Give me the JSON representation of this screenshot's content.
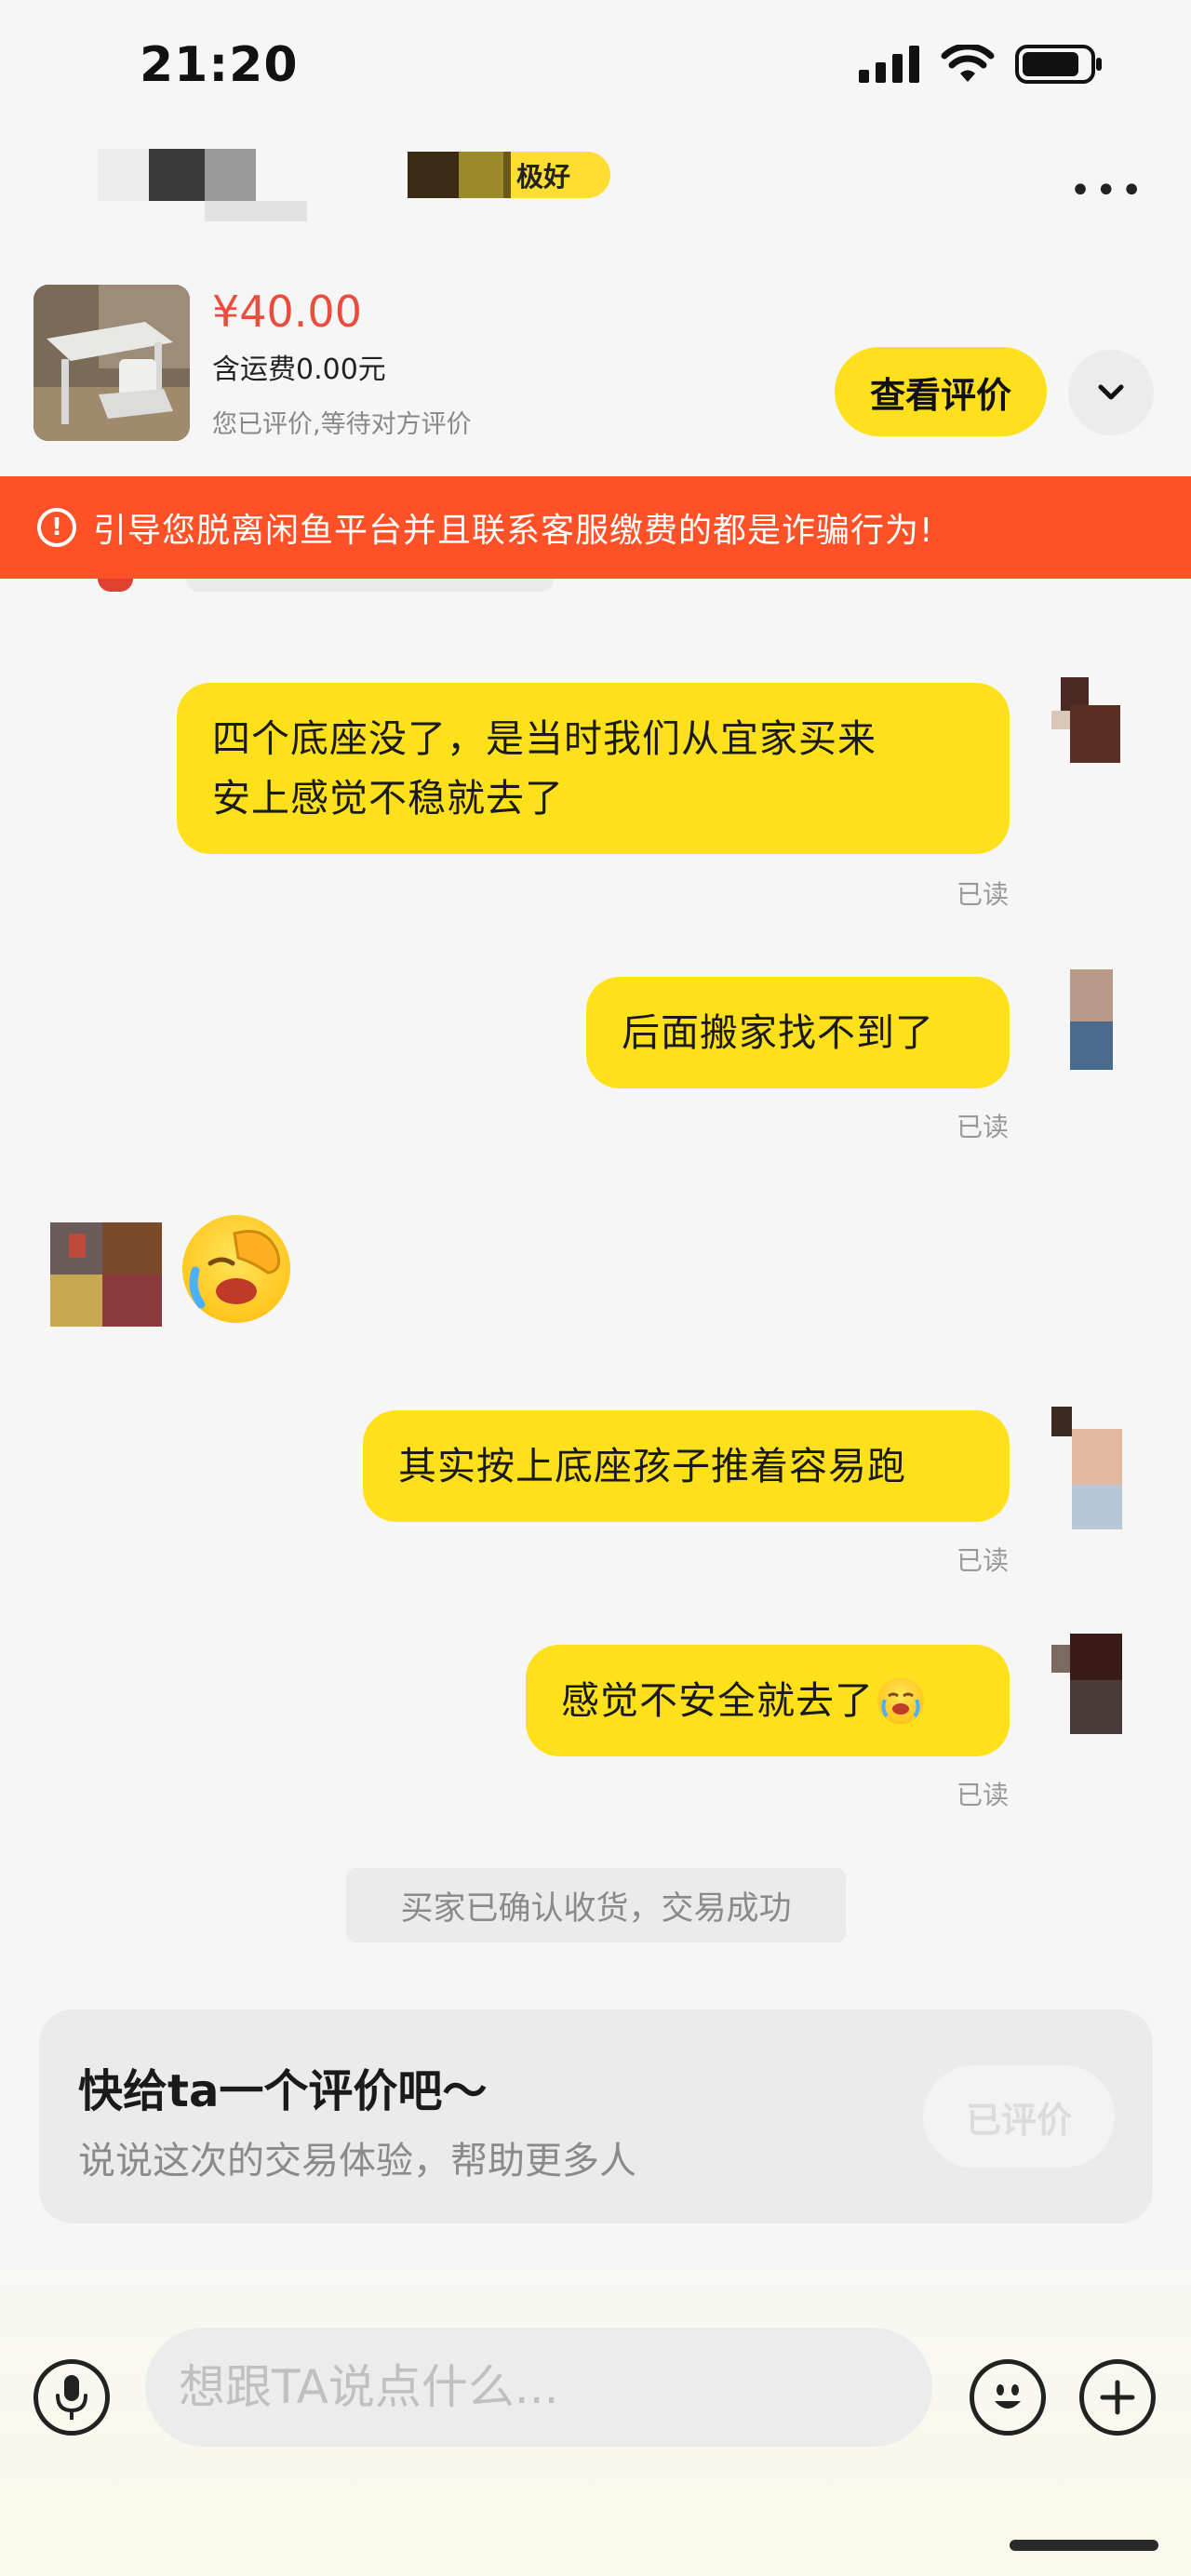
{
  "status_bar": {
    "time": "21:20"
  },
  "header": {
    "credit_badge": "极好",
    "more_icon": "more-icon"
  },
  "product": {
    "price": "¥40.00",
    "shipping": "含运费0.00元",
    "review_status": "您已评价,等待对方评价",
    "view_review_label": "查看评价"
  },
  "warning": {
    "icon": "!",
    "text": "引导您脱离闲鱼平台并且联系客服缴费的都是诈骗行为!"
  },
  "messages": [
    {
      "sender": "me",
      "text": "四个底座没了，是当时我们从宜家买来安上感觉不稳就去了",
      "line1": "四个底座没了，是当时我们从宜家买来",
      "line2": "安上感觉不稳就去了",
      "status": "已读"
    },
    {
      "sender": "me",
      "text": "后面搬家找不到了",
      "status": "已读"
    },
    {
      "sender": "other",
      "text": "",
      "emoji": "facepalm-crying-emoji"
    },
    {
      "sender": "me",
      "text": "其实按上底座孩子推着容易跑",
      "status": "已读"
    },
    {
      "sender": "me",
      "text": "感觉不安全就去了",
      "emoji": "crying-emoji",
      "status": "已读"
    }
  ],
  "system_message": "买家已确认收货，交易成功",
  "review_prompt": {
    "title": "快给ta一个评价吧～",
    "subtitle": "说说这次的交易体验，帮助更多人",
    "button_label": "已评价"
  },
  "input": {
    "placeholder": "想跟TA说点什么..."
  },
  "colors": {
    "accent": "#ffe11b",
    "warning": "#ff5127",
    "price": "#e84d3d"
  }
}
